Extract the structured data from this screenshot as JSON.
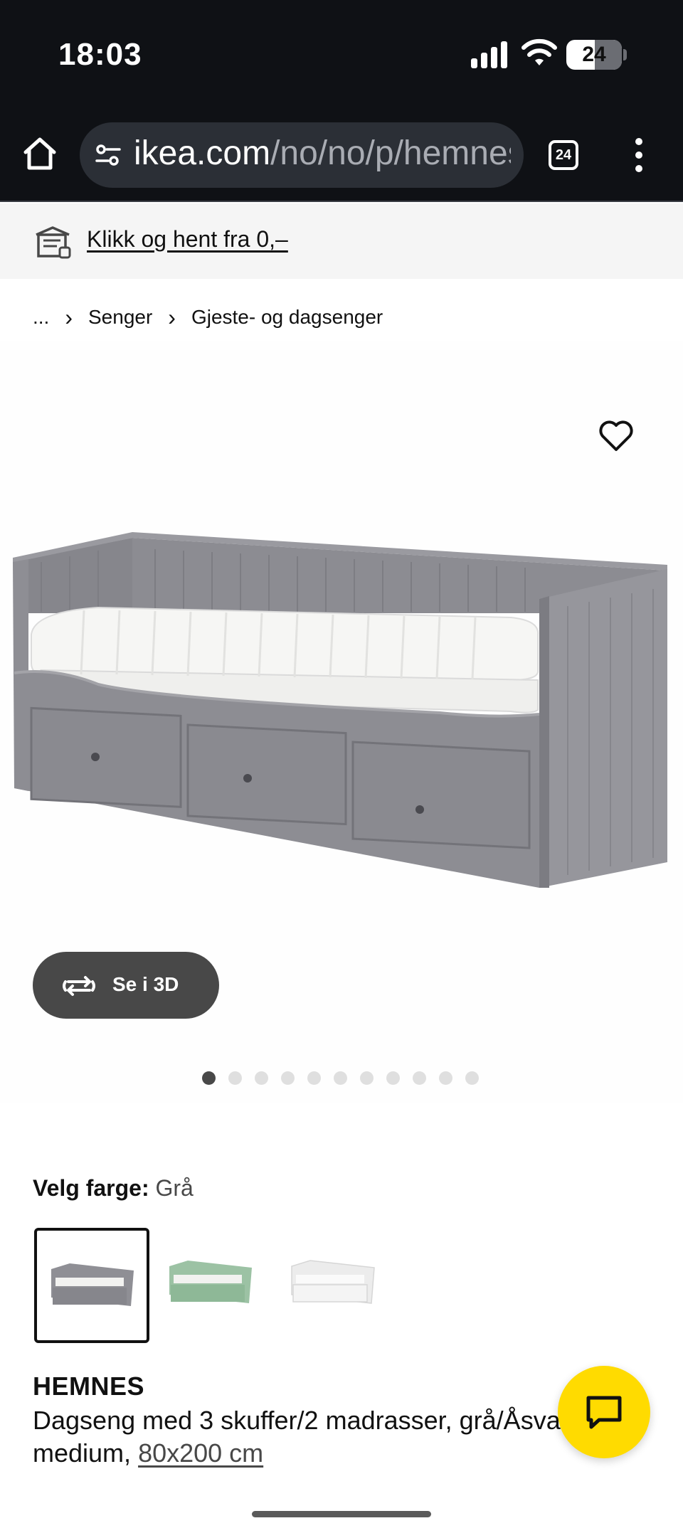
{
  "status_bar": {
    "time": "18:03",
    "battery_level": "24",
    "icons": [
      "signal-icon",
      "wifi-icon",
      "battery-icon"
    ]
  },
  "browser": {
    "url_host": "ikea.com",
    "url_path": "/no/no/p/hemnes",
    "tab_count": "24",
    "icons": [
      "home-icon",
      "site-settings-icon",
      "tabs-icon",
      "more-menu-icon"
    ]
  },
  "pickup_banner": {
    "text": "Klikk og hent fra 0,–",
    "icon": "store-icon"
  },
  "breadcrumb": {
    "ellipsis": "...",
    "items": [
      "Senger",
      "Gjeste- og dagsenger"
    ],
    "separator": "›"
  },
  "gallery": {
    "view_3d_label": "Se i 3D",
    "image_count": 11,
    "active_index": 0
  },
  "color_select": {
    "label": "Velg farge:",
    "value": "Grå",
    "options": [
      {
        "name": "grey",
        "color": "#8f8f95",
        "selected": true
      },
      {
        "name": "green",
        "color": "#9cc2a4",
        "selected": false
      },
      {
        "name": "white",
        "color": "#f0f0f0",
        "selected": false
      }
    ]
  },
  "product": {
    "name": "HEMNES",
    "description_line1": "Dagseng med 3 skuffer/2 madrasser, grå/Åsvang",
    "description_line2": "medium,",
    "size": "80x200 cm"
  },
  "colors": {
    "chrome_dark": "#0f1115",
    "url_pill": "#2b2f36",
    "chat_accent": "#ffdb00",
    "button_dark": "#484848"
  }
}
